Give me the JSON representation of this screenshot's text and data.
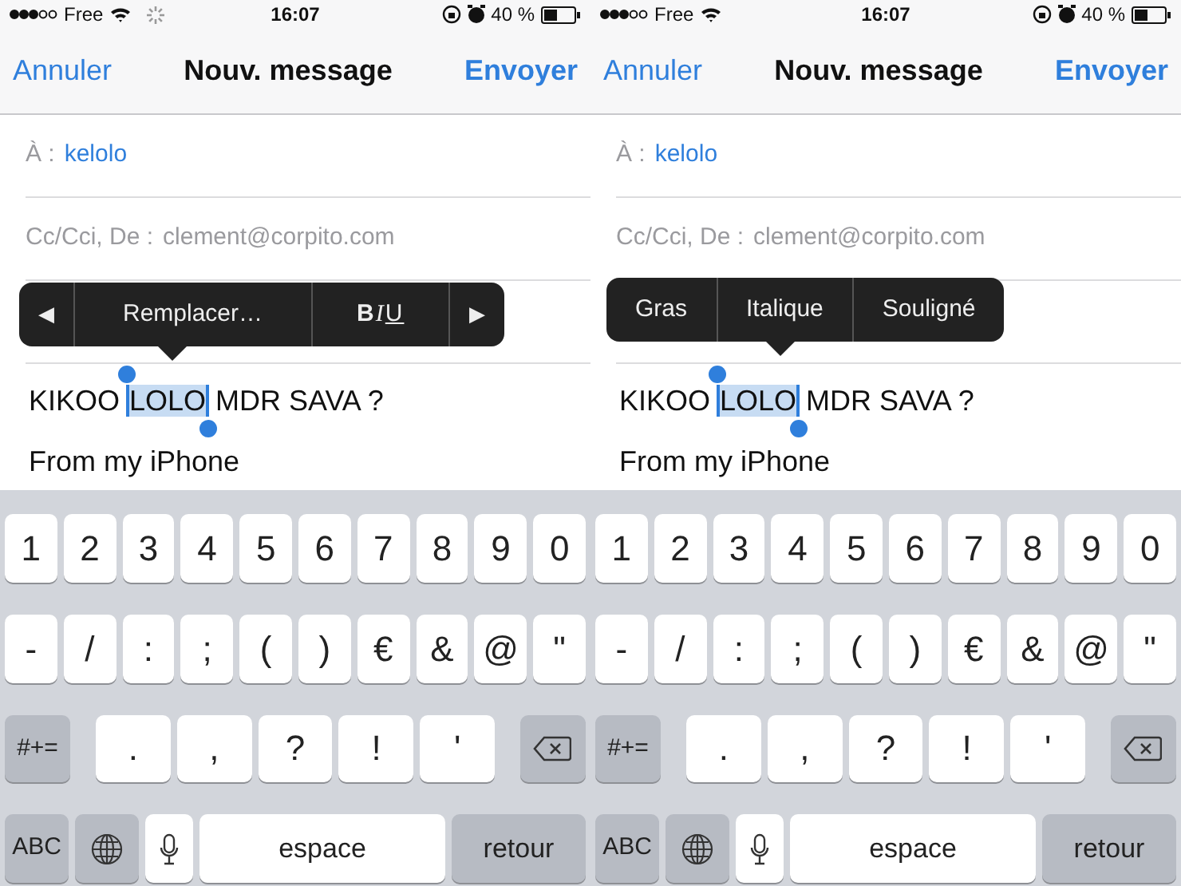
{
  "panels": [
    {
      "status": {
        "carrier": "Free",
        "time": "16:07",
        "battery": "40 %",
        "activity": true
      },
      "nav": {
        "cancel": "Annuler",
        "title": "Nouv. message",
        "send": "Envoyer"
      },
      "to": {
        "label": "À :",
        "value": "kelolo"
      },
      "cc": {
        "label": "Cc/Cci, De :",
        "value": "clement@corpito.com"
      },
      "popup": {
        "items": [
          {
            "kind": "arrow",
            "label": "◀"
          },
          {
            "kind": "text",
            "label": "Remplacer…"
          },
          {
            "kind": "format",
            "bold": "B",
            "italic": "I",
            "underline": "U"
          },
          {
            "kind": "arrow",
            "label": "▶"
          }
        ]
      },
      "body": {
        "before": "KIKOO",
        "selected": "LOLO",
        "after": "MDR SAVA ?",
        "signature": "From my iPhone"
      },
      "keyboard": [
        [
          {
            "kind": "char",
            "label": "1"
          },
          {
            "kind": "char",
            "label": "2"
          },
          {
            "kind": "char",
            "label": "3"
          },
          {
            "kind": "char",
            "label": "4"
          },
          {
            "kind": "char",
            "label": "5"
          },
          {
            "kind": "char",
            "label": "6"
          },
          {
            "kind": "char",
            "label": "7"
          },
          {
            "kind": "char",
            "label": "8"
          },
          {
            "kind": "char",
            "label": "9"
          },
          {
            "kind": "char",
            "label": "0"
          }
        ],
        [
          {
            "kind": "char",
            "label": "-"
          },
          {
            "kind": "char",
            "label": "/"
          },
          {
            "kind": "char",
            "label": ":"
          },
          {
            "kind": "char",
            "label": ";"
          },
          {
            "kind": "char",
            "label": "("
          },
          {
            "kind": "char",
            "label": ")"
          },
          {
            "kind": "char",
            "label": "€"
          },
          {
            "kind": "char",
            "label": "&"
          },
          {
            "kind": "char",
            "label": "@"
          },
          {
            "kind": "char",
            "label": "\""
          }
        ],
        [
          {
            "kind": "mode",
            "label": "#+="
          },
          {
            "kind": "punct",
            "label": "."
          },
          {
            "kind": "punct",
            "label": ","
          },
          {
            "kind": "punct",
            "label": "?"
          },
          {
            "kind": "punct",
            "label": "!"
          },
          {
            "kind": "punct",
            "label": "'"
          },
          {
            "kind": "delete"
          }
        ],
        [
          {
            "kind": "mode",
            "label": "ABC"
          },
          {
            "kind": "globe"
          },
          {
            "kind": "mic"
          },
          {
            "kind": "space",
            "label": "espace"
          },
          {
            "kind": "return",
            "label": "retour"
          }
        ]
      ]
    },
    {
      "status": {
        "carrier": "Free",
        "time": "16:07",
        "battery": "40 %",
        "activity": false
      },
      "nav": {
        "cancel": "Annuler",
        "title": "Nouv. message",
        "send": "Envoyer"
      },
      "to": {
        "label": "À :",
        "value": "kelolo"
      },
      "cc": {
        "label": "Cc/Cci, De :",
        "value": "clement@corpito.com"
      },
      "popup": {
        "items": [
          {
            "kind": "text",
            "label": "Gras"
          },
          {
            "kind": "text",
            "label": "Italique"
          },
          {
            "kind": "text",
            "label": "Souligné"
          }
        ]
      },
      "body": {
        "before": "KIKOO",
        "selected": "LOLO",
        "after": "MDR SAVA ?",
        "signature": "From my iPhone"
      },
      "keyboard": [
        [
          {
            "kind": "char",
            "label": "1"
          },
          {
            "kind": "char",
            "label": "2"
          },
          {
            "kind": "char",
            "label": "3"
          },
          {
            "kind": "char",
            "label": "4"
          },
          {
            "kind": "char",
            "label": "5"
          },
          {
            "kind": "char",
            "label": "6"
          },
          {
            "kind": "char",
            "label": "7"
          },
          {
            "kind": "char",
            "label": "8"
          },
          {
            "kind": "char",
            "label": "9"
          },
          {
            "kind": "char",
            "label": "0"
          }
        ],
        [
          {
            "kind": "char",
            "label": "-"
          },
          {
            "kind": "char",
            "label": "/"
          },
          {
            "kind": "char",
            "label": ":"
          },
          {
            "kind": "char",
            "label": ";"
          },
          {
            "kind": "char",
            "label": "("
          },
          {
            "kind": "char",
            "label": ")"
          },
          {
            "kind": "char",
            "label": "€"
          },
          {
            "kind": "char",
            "label": "&"
          },
          {
            "kind": "char",
            "label": "@"
          },
          {
            "kind": "char",
            "label": "\""
          }
        ],
        [
          {
            "kind": "mode",
            "label": "#+="
          },
          {
            "kind": "punct",
            "label": "."
          },
          {
            "kind": "punct",
            "label": ","
          },
          {
            "kind": "punct",
            "label": "?"
          },
          {
            "kind": "punct",
            "label": "!"
          },
          {
            "kind": "punct",
            "label": "'"
          },
          {
            "kind": "delete"
          }
        ],
        [
          {
            "kind": "mode",
            "label": "ABC"
          },
          {
            "kind": "globe"
          },
          {
            "kind": "mic"
          },
          {
            "kind": "space",
            "label": "espace"
          },
          {
            "kind": "return",
            "label": "retour"
          }
        ]
      ]
    }
  ]
}
